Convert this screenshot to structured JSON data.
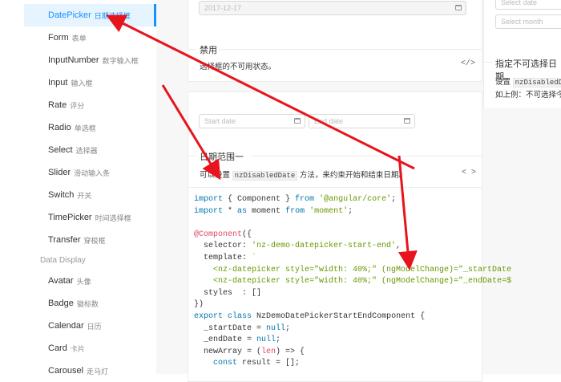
{
  "sidebar": {
    "items": [
      {
        "en": "DatePicker",
        "cn": "日期选择框",
        "active": true
      },
      {
        "en": "Form",
        "cn": "表单"
      },
      {
        "en": "InputNumber",
        "cn": "数字输入框"
      },
      {
        "en": "Input",
        "cn": "输入框"
      },
      {
        "en": "Rate",
        "cn": "评分"
      },
      {
        "en": "Radio",
        "cn": "单选框"
      },
      {
        "en": "Select",
        "cn": "选择器"
      },
      {
        "en": "Slider",
        "cn": "滑动输入条"
      },
      {
        "en": "Switch",
        "cn": "开关"
      },
      {
        "en": "TimePicker",
        "cn": "时间选择框"
      },
      {
        "en": "Transfer",
        "cn": "穿梭框"
      }
    ],
    "group_label": "Data Display",
    "items2": [
      {
        "en": "Avatar",
        "cn": "头像"
      },
      {
        "en": "Badge",
        "cn": "徽标数"
      },
      {
        "en": "Calendar",
        "cn": "日历"
      },
      {
        "en": "Card",
        "cn": "卡片"
      },
      {
        "en": "Carousel",
        "cn": "走马灯"
      }
    ]
  },
  "demo1": {
    "input_value": "2017-12-17",
    "title": "禁用",
    "desc": "选择框的不可用状态。",
    "code_icon": "</>"
  },
  "demo2": {
    "start_placeholder": "Start date",
    "end_placeholder": "End date",
    "title": "日期范围一",
    "desc_prefix": "可以设置",
    "desc_code": "nzDisabledDate",
    "desc_suffix": "方法，来约束开始和结束日期。",
    "code_icon": "< >"
  },
  "right": {
    "select_date_placeholder": "Select date",
    "select_month_placeholder": "Select month",
    "title": "指定不可选择日期",
    "desc_prefix": "设置",
    "desc_code": "nzDisabledDat",
    "desc2": "如上例：不可选择今天之"
  },
  "code_lines": [
    "import { Component } from '@angular/core';",
    "import * as moment from 'moment';",
    "",
    "@Component({",
    "  selector: 'nz-demo-datepicker-start-end',",
    "  template: `",
    "    <nz-datepicker style=\"width: 40%;\" (ngModelChange)=\"_startDate",
    "    <nz-datepicker style=\"width: 40%;\" (ngModelChange)=\"_endDate=$",
    "  styles  : []",
    "})",
    "export class NzDemoDatePickerStartEndComponent {",
    "  _startDate = null;",
    "  _endDate = null;",
    "  newArray = (len) => {",
    "    const result = [];"
  ],
  "colors": {
    "accent": "#1890ff",
    "arrow": "#e8141d"
  }
}
